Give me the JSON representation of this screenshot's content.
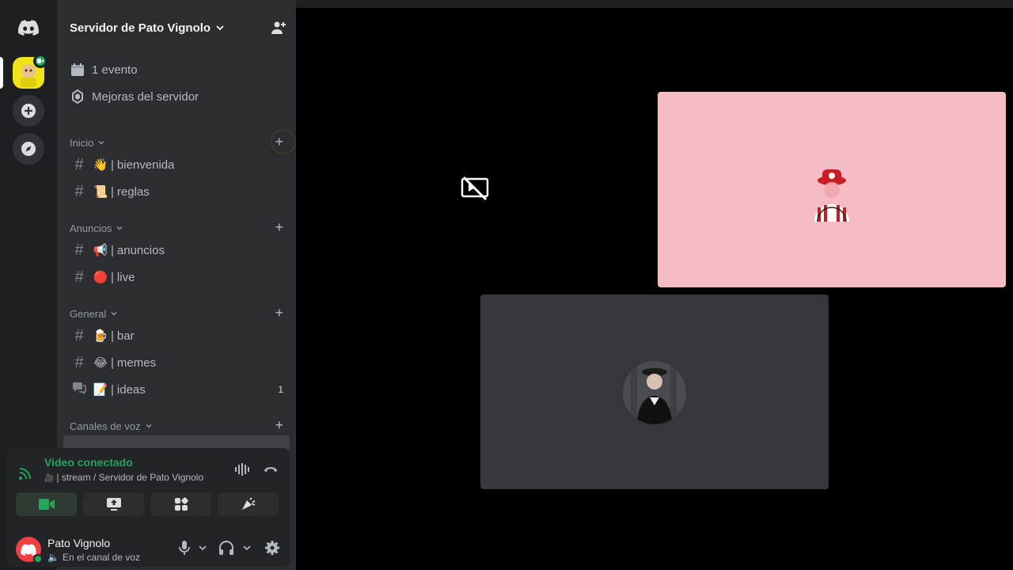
{
  "server": {
    "name": "Servidor de Pato Vignolo",
    "top_items": [
      "1 evento",
      "Mejoras del servidor"
    ]
  },
  "categories": [
    {
      "label": "Inicio",
      "channels": [
        {
          "emoji": "👋",
          "name": "bienvenida"
        },
        {
          "emoji": "📜",
          "name": "reglas"
        }
      ]
    },
    {
      "label": "Anuncios",
      "channels": [
        {
          "emoji": "📢",
          "name": "anuncios"
        },
        {
          "emoji": "🔴",
          "name": "live"
        }
      ]
    },
    {
      "label": "General",
      "channels": [
        {
          "emoji": "🍺",
          "name": "bar"
        },
        {
          "emoji": "😂",
          "name": "memes"
        },
        {
          "emoji": "📝",
          "name": "ideas",
          "count": "1"
        }
      ]
    },
    {
      "label": "Canales de voz"
    }
  ],
  "voice": {
    "title": "Video conectado",
    "subtitle": "| stream / Servidor de Pato Vignolo"
  },
  "user": {
    "name": "Pato Vignolo",
    "status": "En el canal de voz"
  },
  "colors": {
    "connected": "#23a55a",
    "pink_tile": "#f5bcc3",
    "gray_tile": "#36373c"
  }
}
